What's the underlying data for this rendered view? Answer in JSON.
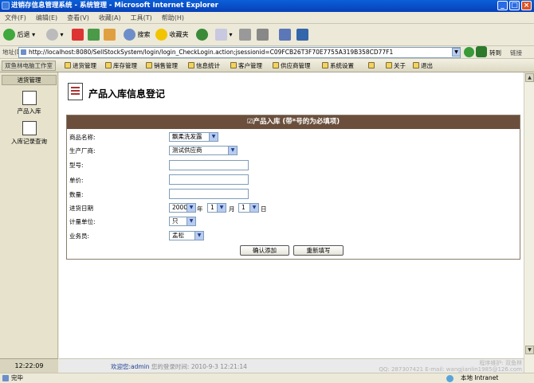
{
  "window": {
    "title": "进销存信息管理系统 - 系统管理 - Microsoft Internet Explorer"
  },
  "menu": [
    "文件(F)",
    "编辑(E)",
    "查看(V)",
    "收藏(A)",
    "工具(T)",
    "帮助(H)"
  ],
  "toolbar": {
    "back": "后退",
    "search": "搜索",
    "favorites": "收藏夹"
  },
  "address": {
    "label": "地址(D)",
    "url": "http://localhost:8080/SellStockSystem/login/login_CheckLogin.action;jsessionid=C09FCB26T3F70E7755A319B358CD77F1",
    "go": "转到",
    "links": "链接"
  },
  "app": {
    "brand": "双鱼林电脑工作室",
    "nav": [
      "进货管理",
      "库存管理",
      "销售管理",
      "信息统计",
      "客户管理",
      "供应商管理",
      "系统设置"
    ],
    "about": "关于",
    "exit": "退出"
  },
  "sidebar": {
    "header": "进货管理",
    "items": [
      "产品入库",
      "入库记录查询"
    ],
    "clock": "12:22:09"
  },
  "page": {
    "title": "产品入库信息登记"
  },
  "form": {
    "header": "☑产品入库 (带*号的为必填项)",
    "fields": {
      "product_label": "商品名称:",
      "product_value": "飘柔洗发露",
      "maker_label": "生产厂商:",
      "maker_value": "测试供应商",
      "model_label": "型号:",
      "price_label": "单价:",
      "qty_label": "数量:",
      "date_label": "进货日期",
      "year": "2000",
      "year_unit": "年",
      "month": "1",
      "month_unit": "月",
      "day": "1",
      "day_unit": "日",
      "unit_label": "计量单位:",
      "unit_value": "只",
      "staff_label": "业务员:",
      "staff_value": "孟松"
    },
    "buttons": {
      "submit": "确认添加",
      "reset": "重新填写"
    }
  },
  "footer": {
    "welcome_prefix": "欢迎您:",
    "user": "admin",
    "login_info": "您的登录时间: 2010-9-3 12:21:14",
    "credit1": "程序维护: 双鱼林",
    "credit2": "QQ: 287307421 E-mail: wangjianlin1985@126.com"
  },
  "status": {
    "text": "完毕",
    "zone": "本地 Intranet"
  }
}
